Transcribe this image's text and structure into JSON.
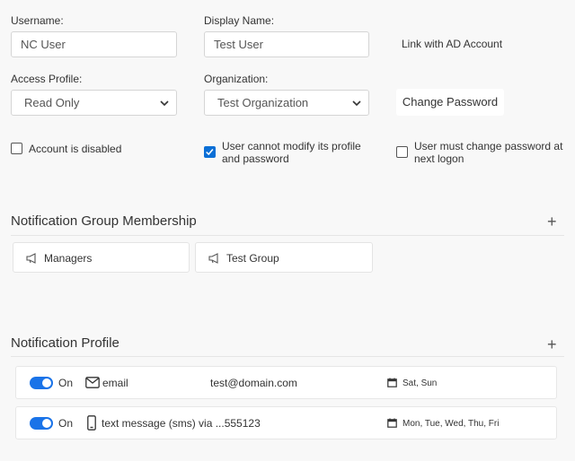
{
  "form": {
    "username_label": "Username:",
    "username_value": "NC User",
    "display_name_label": "Display Name:",
    "display_name_value": "Test User",
    "link_ad": "Link with AD Account",
    "access_profile_label": "Access Profile:",
    "access_profile_value": "Read Only",
    "organization_label": "Organization:",
    "organization_value": "Test Organization",
    "change_password": "Change Password",
    "account_disabled": "Account is disabled",
    "account_disabled_checked": false,
    "cannot_modify_line1": "User cannot modify its profile",
    "cannot_modify_line2": "and password",
    "cannot_modify_checked": true,
    "must_change_line1": "User must change password at",
    "must_change_line2": "next logon",
    "must_change_checked": false
  },
  "groups": {
    "title": "Notification Group Membership",
    "add": "+",
    "items": [
      {
        "label": "Managers",
        "icon": "megaphone-icon"
      },
      {
        "label": "Test Group",
        "icon": "megaphone-icon"
      }
    ]
  },
  "profile": {
    "title": "Notification Profile",
    "add": "+",
    "rows": [
      {
        "state": "On",
        "icon": "envelope-icon",
        "channel": "email",
        "target": "test@domain.com",
        "days": "Sat, Sun"
      },
      {
        "state": "On",
        "icon": "phone-icon",
        "channel": "text message (sms) via ...555123",
        "target": "",
        "days": "Mon, Tue, Wed, Thu, Fri"
      }
    ]
  },
  "colors": {
    "accent": "#1a73e8",
    "checkbox": "#0b6fd6"
  }
}
